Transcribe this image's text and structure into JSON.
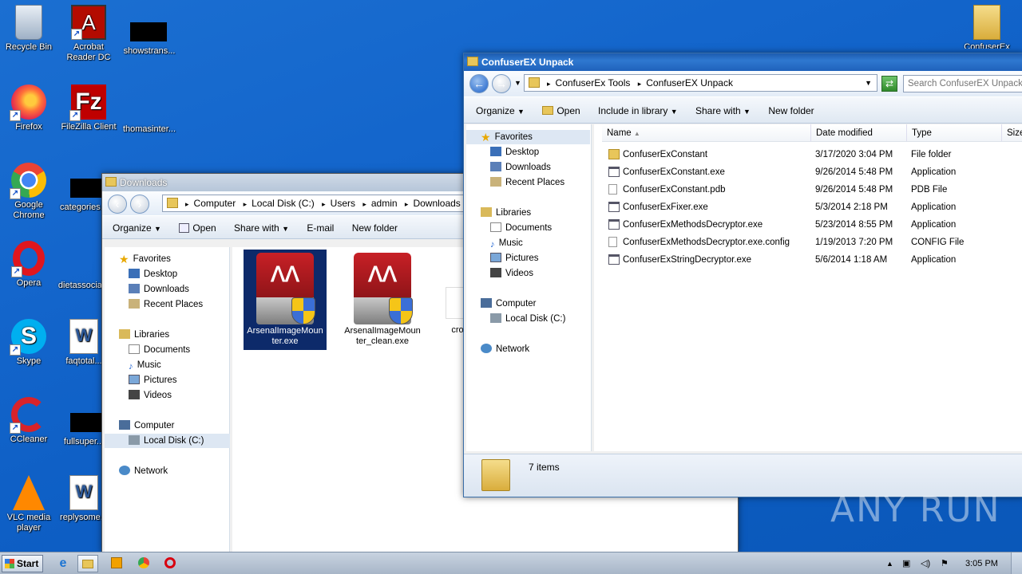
{
  "desktop": {
    "icons": [
      {
        "label": "Recycle Bin"
      },
      {
        "label": "Acrobat Reader DC"
      },
      {
        "label": "showstrans..."
      },
      {
        "label": "Firefox"
      },
      {
        "label": "FileZilla Client"
      },
      {
        "label": "thomasinter..."
      },
      {
        "label": "Google Chrome"
      },
      {
        "label": "categories..."
      },
      {
        "label": "Opera"
      },
      {
        "label": "dietassocia..."
      },
      {
        "label": "Skype"
      },
      {
        "label": "faqtotal..."
      },
      {
        "label": "CCleaner"
      },
      {
        "label": "fullsuper..."
      },
      {
        "label": "VLC media player"
      },
      {
        "label": "replysome..."
      },
      {
        "label": "ConfuserEx"
      }
    ]
  },
  "downloads_window": {
    "title": "Downloads",
    "breadcrumb": [
      "Computer",
      "Local Disk (C:)",
      "Users",
      "admin",
      "Downloads"
    ],
    "toolbar": [
      "Organize",
      "Open",
      "Share with",
      "E-mail",
      "New folder"
    ],
    "nav": {
      "favorites": "Favorites",
      "favorites_items": [
        "Desktop",
        "Downloads",
        "Recent Places"
      ],
      "libraries": "Libraries",
      "libraries_items": [
        "Documents",
        "Music",
        "Pictures",
        "Videos"
      ],
      "computer": "Computer",
      "computer_items": [
        "Local Disk (C:)"
      ],
      "network": "Network"
    },
    "files": [
      {
        "name": "ArsenalImageMounter.exe"
      },
      {
        "name": "ArsenalImageMounter_clean.exe"
      },
      {
        "name": "cro"
      }
    ]
  },
  "confuser_window": {
    "title": "ConfuserEX Unpack",
    "breadcrumb": [
      "ConfuserEx Tools",
      "ConfuserEX Unpack"
    ],
    "search_placeholder": "Search ConfuserEX Unpack",
    "toolbar": [
      "Organize",
      "Open",
      "Include in library",
      "Share with",
      "New folder"
    ],
    "nav": {
      "favorites": "Favorites",
      "favorites_items": [
        "Desktop",
        "Downloads",
        "Recent Places"
      ],
      "libraries": "Libraries",
      "libraries_items": [
        "Documents",
        "Music",
        "Pictures",
        "Videos"
      ],
      "computer": "Computer",
      "computer_items": [
        "Local Disk (C:)"
      ],
      "network": "Network"
    },
    "columns": [
      "Name",
      "Date modified",
      "Type",
      "Size"
    ],
    "rows": [
      {
        "name": "ConfuserExConstant",
        "date": "3/17/2020 3:04 PM",
        "type": "File folder"
      },
      {
        "name": "ConfuserExConstant.exe",
        "date": "9/26/2014 5:48 PM",
        "type": "Application"
      },
      {
        "name": "ConfuserExConstant.pdb",
        "date": "9/26/2014 5:48 PM",
        "type": "PDB File"
      },
      {
        "name": "ConfuserExFixer.exe",
        "date": "5/3/2014 2:18 PM",
        "type": "Application"
      },
      {
        "name": "ConfuserExMethodsDecryptor.exe",
        "date": "5/23/2014 8:55 PM",
        "type": "Application"
      },
      {
        "name": "ConfuserExMethodsDecryptor.exe.config",
        "date": "1/19/2013 7:20 PM",
        "type": "CONFIG File"
      },
      {
        "name": "ConfuserExStringDecryptor.exe",
        "date": "5/6/2014 1:18 AM",
        "type": "Application"
      }
    ],
    "status": "7 items"
  },
  "taskbar": {
    "start": "Start",
    "clock": "3:05 PM"
  },
  "watermark": "ANY RUN"
}
